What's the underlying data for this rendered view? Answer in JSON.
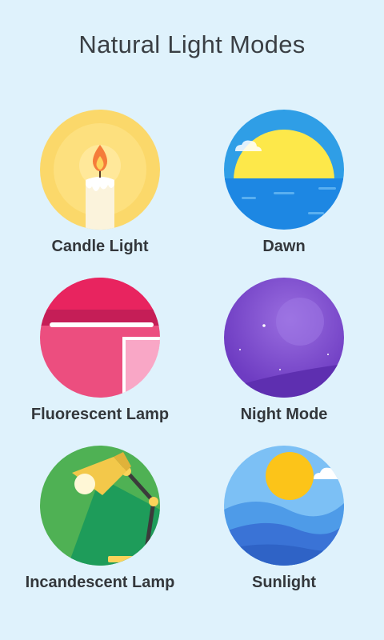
{
  "header": {
    "title": "Natural Light Modes"
  },
  "modes": [
    {
      "label": "Candle Light",
      "icon": "candle-icon"
    },
    {
      "label": "Dawn",
      "icon": "dawn-icon"
    },
    {
      "label": "Fluorescent Lamp",
      "icon": "fluorescent-lamp-icon"
    },
    {
      "label": "Night Mode",
      "icon": "moon-icon"
    },
    {
      "label": "Incandescent Lamp",
      "icon": "desk-lamp-icon"
    },
    {
      "label": "Sunlight",
      "icon": "sun-icon"
    }
  ],
  "colors": {
    "background": "#dff2fc",
    "candle": "#fbd86a",
    "dawn_sky": "#2f9ee6",
    "fluorescent": "#ec4e7f",
    "night": "#7b47c9",
    "incandescent": "#4fb154",
    "sunlight": "#4e9be8"
  }
}
